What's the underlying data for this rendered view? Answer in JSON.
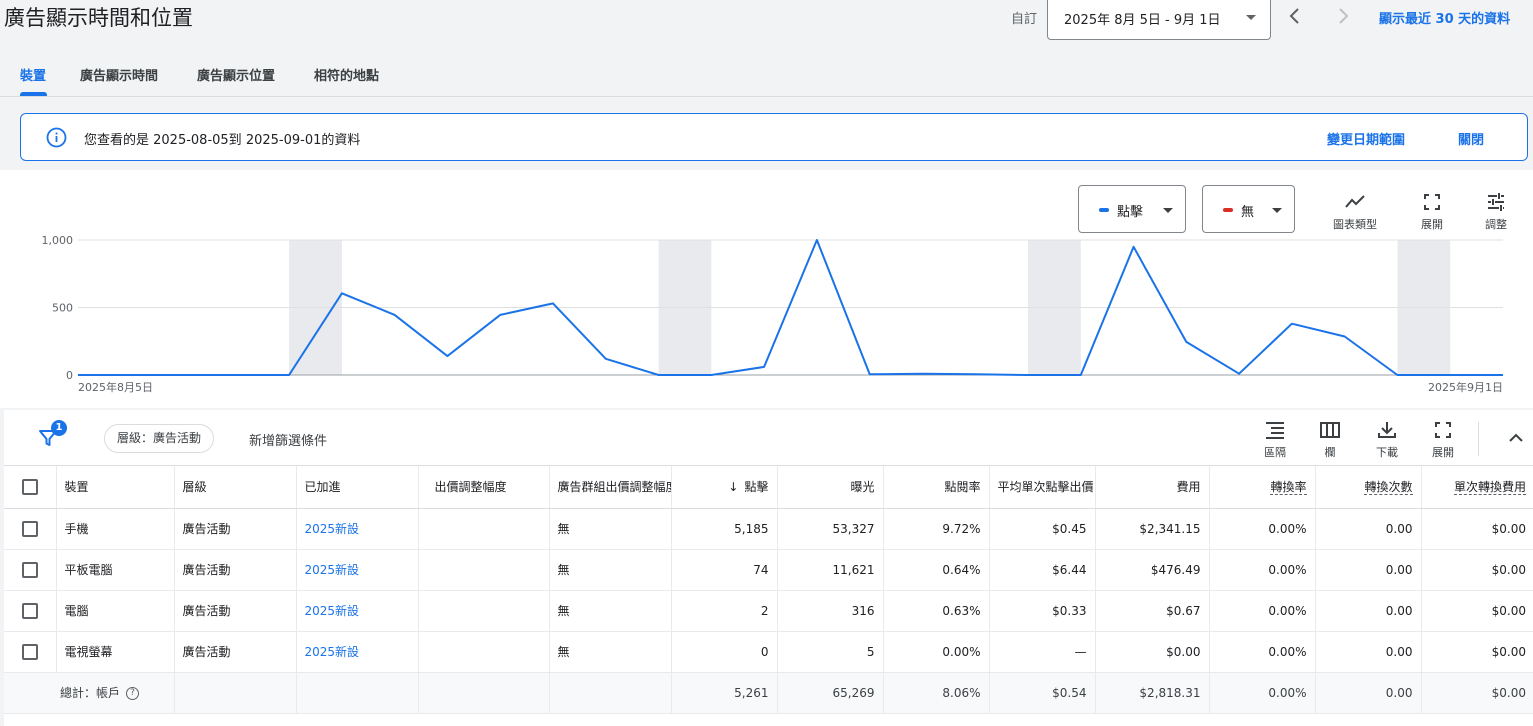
{
  "header": {
    "title": "廣告顯示時間和位置",
    "custom_label": "自訂",
    "date_range": "2025年 8月 5日 - 9月 1日",
    "last30_link": "顯示最近 30 天的資料"
  },
  "tabs": [
    {
      "label": "裝置",
      "active": true
    },
    {
      "label": "廣告顯示時間",
      "active": false
    },
    {
      "label": "廣告顯示位置",
      "active": false
    },
    {
      "label": "相符的地點",
      "active": false
    }
  ],
  "banner": {
    "message": "您查看的是 2025-08-05到 2025-09-01的資料",
    "change_link": "變更日期範圍",
    "close_link": "關閉"
  },
  "chart_controls": {
    "metric1": "點擊",
    "metric1_color": "#1a73e8",
    "metric2": "無",
    "metric2_color": "#d93025",
    "chart_type_label": "圖表類型",
    "expand_label": "展開",
    "adjust_label": "調整"
  },
  "chart_data": {
    "type": "line",
    "x_start_label": "2025年8月5日",
    "x_end_label": "2025年9月1日",
    "y_ticks": [
      "1,000",
      "500",
      "0"
    ],
    "ylim": [
      0,
      1000
    ],
    "series": [
      {
        "name": "點擊",
        "color": "#1a73e8",
        "values": [
          0,
          0,
          0,
          0,
          0,
          605,
          445,
          140,
          445,
          530,
          120,
          0,
          0,
          60,
          1000,
          5,
          10,
          5,
          0,
          0,
          950,
          245,
          10,
          380,
          285,
          0,
          0,
          0
        ]
      }
    ],
    "weekend_bands": [
      [
        4,
        5
      ],
      [
        11,
        12
      ],
      [
        18,
        19
      ],
      [
        25,
        26
      ]
    ]
  },
  "toolbar": {
    "filter_count": "1",
    "filter_chip": "層級：廣告活動",
    "add_filter": "新增篩選條件",
    "segment_label": "區隔",
    "columns_label": "欄",
    "download_label": "下載",
    "expand_label": "展開"
  },
  "table": {
    "columns": [
      "裝置",
      "層級",
      "已加進",
      "出價調整幅度",
      "廣告群組出價調整幅度",
      "點擊",
      "曝光",
      "點閱率",
      "平均單次點擊出價",
      "費用",
      "轉換率",
      "轉換次數",
      "單次轉換費用"
    ],
    "rows": [
      {
        "device": "手機",
        "level": "廣告活動",
        "added": "2025新設",
        "bid_adj": "",
        "ag_bid_adj": "無",
        "clicks": "5,185",
        "impr": "53,327",
        "ctr": "9.72%",
        "avg_cpc": "$0.45",
        "cost": "$2,341.15",
        "conv_rate": "0.00%",
        "conv": "0.00",
        "cost_conv": "$0.00"
      },
      {
        "device": "平板電腦",
        "level": "廣告活動",
        "added": "2025新設",
        "bid_adj": "",
        "ag_bid_adj": "無",
        "clicks": "74",
        "impr": "11,621",
        "ctr": "0.64%",
        "avg_cpc": "$6.44",
        "cost": "$476.49",
        "conv_rate": "0.00%",
        "conv": "0.00",
        "cost_conv": "$0.00"
      },
      {
        "device": "電腦",
        "level": "廣告活動",
        "added": "2025新設",
        "bid_adj": "",
        "ag_bid_adj": "無",
        "clicks": "2",
        "impr": "316",
        "ctr": "0.63%",
        "avg_cpc": "$0.33",
        "cost": "$0.67",
        "conv_rate": "0.00%",
        "conv": "0.00",
        "cost_conv": "$0.00"
      },
      {
        "device": "電視螢幕",
        "level": "廣告活動",
        "added": "2025新設",
        "bid_adj": "",
        "ag_bid_adj": "無",
        "clicks": "0",
        "impr": "5",
        "ctr": "0.00%",
        "avg_cpc": "—",
        "cost": "$0.00",
        "conv_rate": "0.00%",
        "conv": "0.00",
        "cost_conv": "$0.00"
      }
    ],
    "total": {
      "label": "總計：帳戶",
      "clicks": "5,261",
      "impr": "65,269",
      "ctr": "8.06%",
      "avg_cpc": "$0.54",
      "cost": "$2,818.31",
      "conv_rate": "0.00%",
      "conv": "0.00",
      "cost_conv": "$0.00"
    }
  }
}
